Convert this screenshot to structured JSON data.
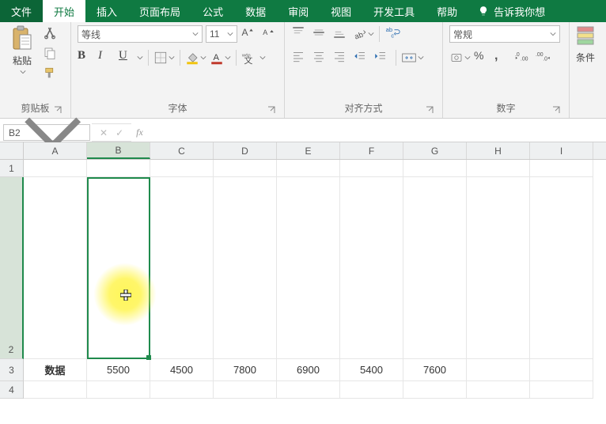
{
  "tabs": {
    "file": "文件",
    "home": "开始",
    "insert": "插入",
    "pagelayout": "页面布局",
    "formulas": "公式",
    "data": "数据",
    "review": "审阅",
    "view": "视图",
    "developer": "开发工具",
    "help": "帮助",
    "tellme": "告诉我你想"
  },
  "ribbon": {
    "clipboard": {
      "paste": "粘贴",
      "label": "剪贴板"
    },
    "font": {
      "name": "等线",
      "size": "11",
      "bold": "B",
      "italic": "I",
      "underline": "U",
      "wen": "wén",
      "label": "字体"
    },
    "alignment": {
      "label": "对齐方式"
    },
    "number": {
      "format": "常规",
      "percent": "%",
      "label": "数字"
    },
    "styles": {
      "cond": "条件"
    }
  },
  "formulaBar": {
    "name": "B2",
    "cancel": "✕",
    "enter": "✓",
    "fx": "fx",
    "value": ""
  },
  "grid": {
    "cols": [
      "A",
      "B",
      "C",
      "D",
      "E",
      "F",
      "G",
      "H",
      "I"
    ],
    "rows": [
      "1",
      "2",
      "3",
      "4"
    ],
    "selectedCol": "B",
    "selectedRow": "2",
    "r3": {
      "A": "数据",
      "B": "5500",
      "C": "4500",
      "D": "7800",
      "E": "6900",
      "F": "5400",
      "G": "7600"
    }
  },
  "colors": {
    "brand": "#0f7a42",
    "accentRed": "#c0392b",
    "accentBlue": "#2b6cb0",
    "accentYellow": "#f1c40f"
  }
}
